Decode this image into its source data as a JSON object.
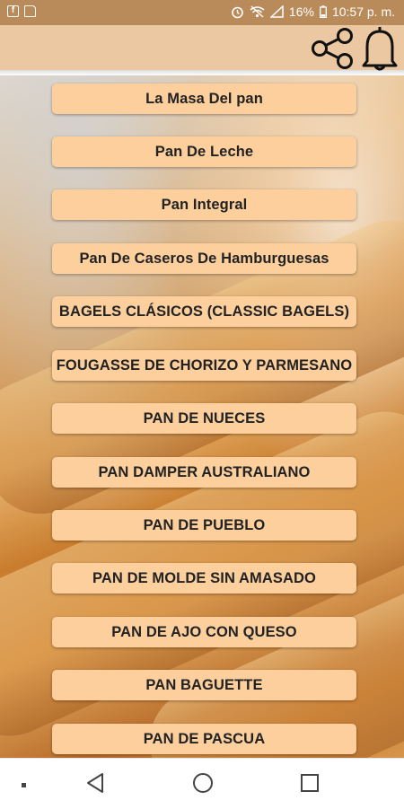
{
  "status_bar": {
    "left_icons": [
      "facebook-icon",
      "sd-card-icon"
    ],
    "battery": "16%",
    "time": "10:57 p. m."
  },
  "app_bar": {
    "background_color": "#ecc8a2",
    "actions": [
      "share-icon",
      "bell-icon"
    ]
  },
  "menu": {
    "button_color": "#fccf9d",
    "items": [
      "La Masa Del pan",
      "Pan De Leche",
      "Pan Integral",
      "Pan De  Caseros De Hamburguesas",
      "BAGELS CLÁSICOS (CLASSIC BAGELS)",
      "FOUGASSE DE CHORIZO Y PARMESANO",
      "PAN DE NUECES",
      "PAN DAMPER AUSTRALIANO",
      "PAN DE PUEBLO",
      "PAN DE MOLDE SIN AMASADO",
      "PAN DE AJO CON QUESO",
      "PAN BAGUETTE",
      "PAN DE PASCUA"
    ]
  },
  "nav_bar": {
    "items": [
      "recents-dot-icon",
      "back-icon",
      "home-icon",
      "overview-icon"
    ]
  }
}
